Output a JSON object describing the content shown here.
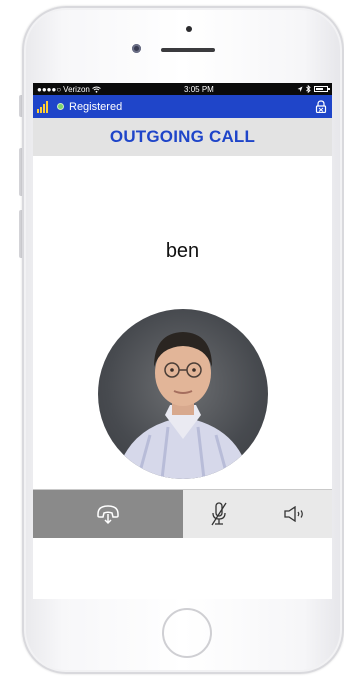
{
  "status_bar": {
    "carrier": "Verizon",
    "time": "3:05 PM"
  },
  "app_bar": {
    "registration_status": "Registered"
  },
  "call": {
    "title": "OUTGOING CALL",
    "contact_name": "ben"
  },
  "controls": {
    "end_call_icon": "hangup-icon",
    "mute_icon": "mic-muted-icon",
    "speaker_icon": "speaker-icon"
  },
  "colors": {
    "accent_blue": "#1f45c9",
    "signal_yellow": "#ffcf33",
    "registered_green": "#7ed66b",
    "end_call_gray": "#8a8a8a"
  }
}
